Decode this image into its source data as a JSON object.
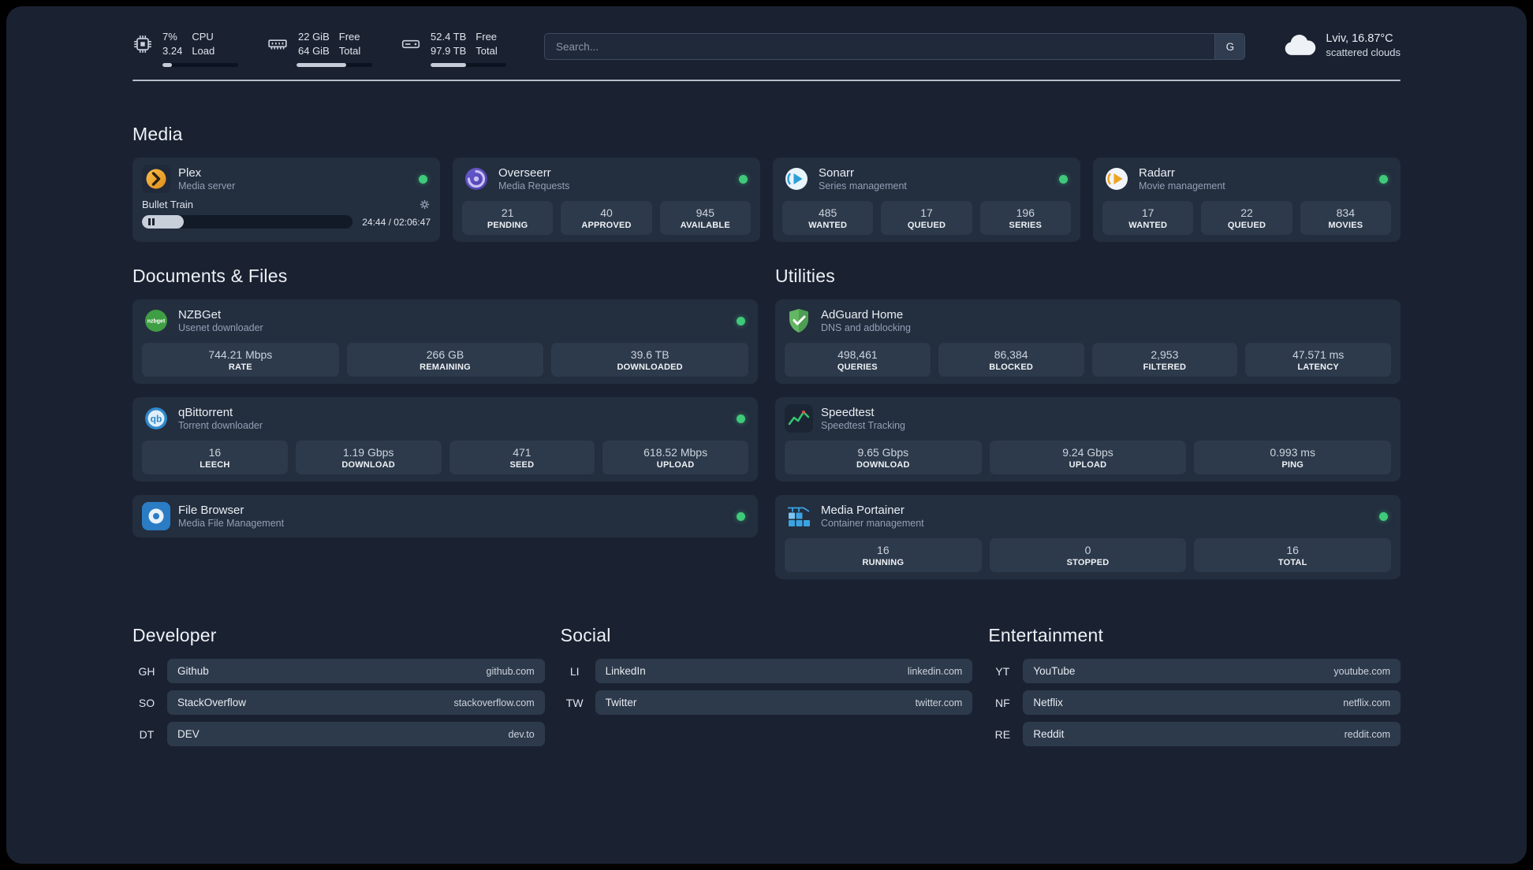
{
  "topbar": {
    "cpu": {
      "value_top": "7%",
      "value_bottom": "3.24",
      "label_top": "CPU",
      "label_bottom": "Load",
      "progress_percent": 12
    },
    "ram": {
      "value_top": "22 GiB",
      "value_bottom": "64 GiB",
      "label_top": "Free",
      "label_bottom": "Total",
      "progress_percent": 66
    },
    "disk": {
      "value_top": "52.4 TB",
      "value_bottom": "97.9 TB",
      "label_top": "Free",
      "label_bottom": "Total",
      "progress_percent": 47
    },
    "search": {
      "placeholder": "Search...",
      "engine_button": "G"
    },
    "weather": {
      "location": "Lviv, 16.87°C",
      "condition": "scattered clouds"
    }
  },
  "sections": {
    "media": {
      "title": "Media",
      "plex": {
        "name": "Plex",
        "subtitle": "Media server",
        "now_playing": "Bullet Train",
        "time_display": "24:44 / 02:06:47",
        "progress_percent": 20
      },
      "overseerr": {
        "name": "Overseerr",
        "subtitle": "Media Requests",
        "stats": [
          {
            "value": "21",
            "label": "PENDING"
          },
          {
            "value": "40",
            "label": "APPROVED"
          },
          {
            "value": "945",
            "label": "AVAILABLE"
          }
        ]
      },
      "sonarr": {
        "name": "Sonarr",
        "subtitle": "Series management",
        "stats": [
          {
            "value": "485",
            "label": "WANTED"
          },
          {
            "value": "17",
            "label": "QUEUED"
          },
          {
            "value": "196",
            "label": "SERIES"
          }
        ]
      },
      "radarr": {
        "name": "Radarr",
        "subtitle": "Movie management",
        "stats": [
          {
            "value": "17",
            "label": "WANTED"
          },
          {
            "value": "22",
            "label": "QUEUED"
          },
          {
            "value": "834",
            "label": "MOVIES"
          }
        ]
      }
    },
    "documents": {
      "title": "Documents & Files",
      "nzbget": {
        "name": "NZBGet",
        "subtitle": "Usenet downloader",
        "stats": [
          {
            "value": "744.21 Mbps",
            "label": "RATE"
          },
          {
            "value": "266 GB",
            "label": "REMAINING"
          },
          {
            "value": "39.6 TB",
            "label": "DOWNLOADED"
          }
        ]
      },
      "qbittorrent": {
        "name": "qBittorrent",
        "subtitle": "Torrent downloader",
        "stats": [
          {
            "value": "16",
            "label": "LEECH"
          },
          {
            "value": "1.19 Gbps",
            "label": "DOWNLOAD"
          },
          {
            "value": "471",
            "label": "SEED"
          },
          {
            "value": "618.52 Mbps",
            "label": "UPLOAD"
          }
        ]
      },
      "filebrowser": {
        "name": "File Browser",
        "subtitle": "Media File Management"
      }
    },
    "utilities": {
      "title": "Utilities",
      "adguard": {
        "name": "AdGuard Home",
        "subtitle": "DNS and adblocking",
        "stats": [
          {
            "value": "498,461",
            "label": "QUERIES"
          },
          {
            "value": "86,384",
            "label": "BLOCKED"
          },
          {
            "value": "2,953",
            "label": "FILTERED"
          },
          {
            "value": "47.571 ms",
            "label": "LATENCY"
          }
        ]
      },
      "speedtest": {
        "name": "Speedtest",
        "subtitle": "Speedtest Tracking",
        "stats": [
          {
            "value": "9.65 Gbps",
            "label": "DOWNLOAD"
          },
          {
            "value": "9.24 Gbps",
            "label": "UPLOAD"
          },
          {
            "value": "0.993 ms",
            "label": "PING"
          }
        ]
      },
      "portainer": {
        "name": "Media Portainer",
        "subtitle": "Container management",
        "stats": [
          {
            "value": "16",
            "label": "RUNNING"
          },
          {
            "value": "0",
            "label": "STOPPED"
          },
          {
            "value": "16",
            "label": "TOTAL"
          }
        ]
      }
    }
  },
  "bookmarks": {
    "developer": {
      "title": "Developer",
      "items": [
        {
          "abbr": "GH",
          "name": "Github",
          "url": "github.com"
        },
        {
          "abbr": "SO",
          "name": "StackOverflow",
          "url": "stackoverflow.com"
        },
        {
          "abbr": "DT",
          "name": "DEV",
          "url": "dev.to"
        }
      ]
    },
    "social": {
      "title": "Social",
      "items": [
        {
          "abbr": "LI",
          "name": "LinkedIn",
          "url": "linkedin.com"
        },
        {
          "abbr": "TW",
          "name": "Twitter",
          "url": "twitter.com"
        }
      ]
    },
    "entertainment": {
      "title": "Entertainment",
      "items": [
        {
          "abbr": "YT",
          "name": "YouTube",
          "url": "youtube.com"
        },
        {
          "abbr": "NF",
          "name": "Netflix",
          "url": "netflix.com"
        },
        {
          "abbr": "RE",
          "name": "Reddit",
          "url": "reddit.com"
        }
      ]
    }
  },
  "colors": {
    "status_online": "#3fca7a",
    "accent_background": "#1a2232",
    "card_background": "#232e3f",
    "tile_background": "#2d3a4b"
  }
}
